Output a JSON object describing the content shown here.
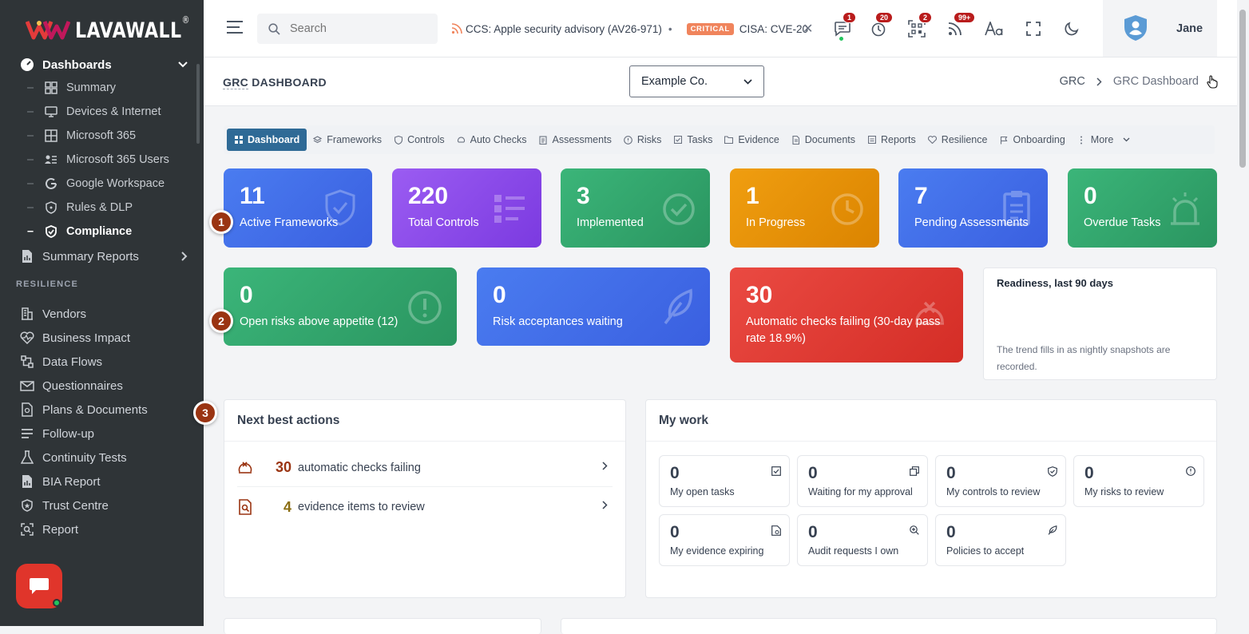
{
  "app": {
    "logo_text": "LAVAWALL",
    "logo_mark": "®"
  },
  "sidebar": {
    "dashboards_label": "Dashboards",
    "sub_items": [
      {
        "label": "Summary"
      },
      {
        "label": "Devices & Internet"
      },
      {
        "label": "Microsoft 365"
      },
      {
        "label": "Microsoft 365 Users"
      },
      {
        "label": "Google Workspace"
      },
      {
        "label": "Rules & DLP"
      },
      {
        "label": "Compliance"
      }
    ],
    "summary_reports_label": "Summary Reports",
    "section_label": "RESILIENCE",
    "resilience_items": [
      {
        "label": "Vendors"
      },
      {
        "label": "Business Impact"
      },
      {
        "label": "Data Flows"
      },
      {
        "label": "Questionnaires"
      },
      {
        "label": "Plans & Documents"
      },
      {
        "label": "Follow-up"
      },
      {
        "label": "Continuity Tests"
      },
      {
        "label": "BIA Report"
      },
      {
        "label": "Trust Centre"
      },
      {
        "label": "Report"
      }
    ]
  },
  "topbar": {
    "search_placeholder": "Search",
    "ticker_item_1": "CCS: Apple security advisory (AV26-971)",
    "ticker_badge": "CRITICAL",
    "ticker_item_2": "CISA: CVE-20",
    "badges": {
      "messages": "1",
      "alerts": "20",
      "scan": "2",
      "feed": "99+"
    },
    "user_name": "Jane"
  },
  "pagehead": {
    "title_prefix": "GRC",
    "title_rest": " DASHBOARD",
    "company": "Example Co.",
    "breadcrumb": [
      "GRC",
      "GRC Dashboard"
    ]
  },
  "tabs": [
    "Dashboard",
    "Frameworks",
    "Controls",
    "Auto Checks",
    "Assessments",
    "Risks",
    "Tasks",
    "Evidence",
    "Documents",
    "Reports",
    "Resilience",
    "Onboarding",
    "More"
  ],
  "stats_row1": [
    {
      "value": "11",
      "label": "Active Frameworks",
      "color": "#3b66e8"
    },
    {
      "value": "220",
      "label": "Total Controls",
      "color": "#8b45e8"
    },
    {
      "value": "3",
      "label": "Implemented",
      "color": "#2ea36a"
    },
    {
      "value": "1",
      "label": "In Progress",
      "color": "#e98d06"
    },
    {
      "value": "7",
      "label": "Pending Assessments",
      "color": "#3b66e8"
    },
    {
      "value": "0",
      "label": "Overdue Tasks",
      "color": "#2ea36a"
    }
  ],
  "stats_row2": [
    {
      "value": "0",
      "label": "Open risks above appetite (12)",
      "color": "#2ea36a"
    },
    {
      "value": "0",
      "label": "Risk acceptances waiting",
      "color": "#3b66e8"
    },
    {
      "value": "30",
      "label": "Automatic checks failing (30-day pass rate 18.9%)",
      "color": "#e03a32"
    }
  ],
  "readiness": {
    "title": "Readiness, last 90 days",
    "note": "The trend fills in as nightly snapshots are recorded."
  },
  "steps": [
    "1",
    "2",
    "3"
  ],
  "next_actions": {
    "title": "Next best actions",
    "items": [
      {
        "count": "30",
        "label": "automatic checks failing"
      },
      {
        "count": "4",
        "label": "evidence items to review"
      }
    ]
  },
  "my_work": {
    "title": "My work",
    "items": [
      {
        "value": "0",
        "label": "My open tasks"
      },
      {
        "value": "0",
        "label": "Waiting for my approval"
      },
      {
        "value": "0",
        "label": "My controls to review"
      },
      {
        "value": "0",
        "label": "My risks to review"
      },
      {
        "value": "0",
        "label": "My evidence expiring"
      },
      {
        "value": "0",
        "label": "Audit requests I own"
      },
      {
        "value": "0",
        "label": "Policies to accept"
      }
    ]
  }
}
